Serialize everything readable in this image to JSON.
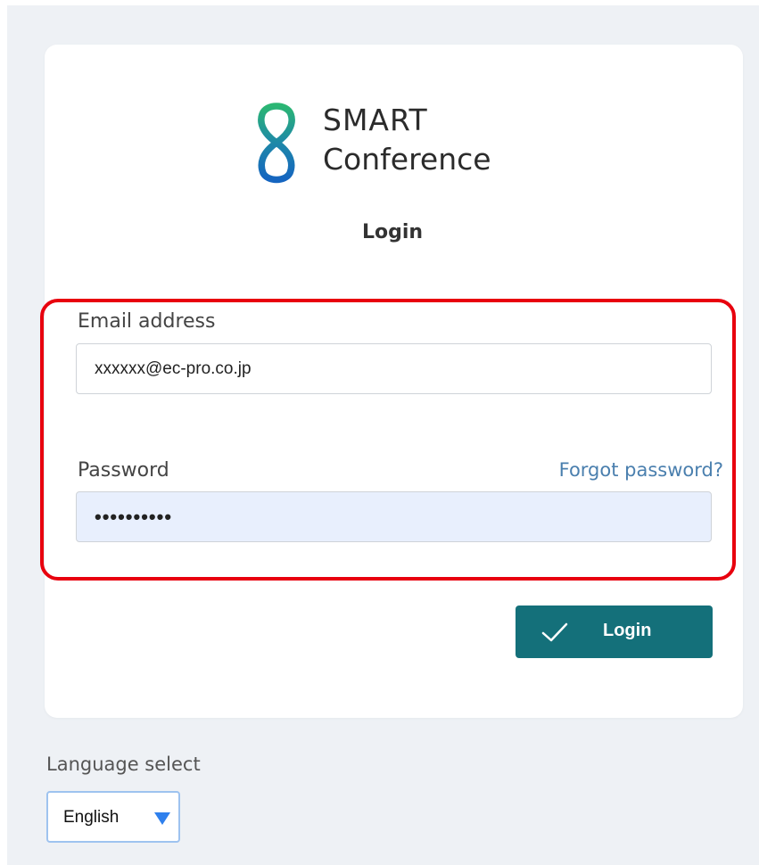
{
  "brand": {
    "line1": "SMART",
    "line2": "Conference",
    "logo_icon": "infinity-eight-logo-icon",
    "logo_gradient": [
      "#2bb673",
      "#1565c0"
    ]
  },
  "login": {
    "title": "Login",
    "email_label": "Email address",
    "email_value": "xxxxxx@ec-pro.co.jp",
    "password_label": "Password",
    "password_value": "••••••••••",
    "forgot_link": "Forgot password?",
    "submit_label": "Login",
    "submit_icon": "check-icon"
  },
  "language": {
    "label": "Language select",
    "selected": "English",
    "dropdown_icon": "caret-down-icon"
  },
  "colors": {
    "accent": "#14707a",
    "highlight": "#e8000e",
    "link": "#4a7fae",
    "autofill_bg": "#e8effd"
  }
}
